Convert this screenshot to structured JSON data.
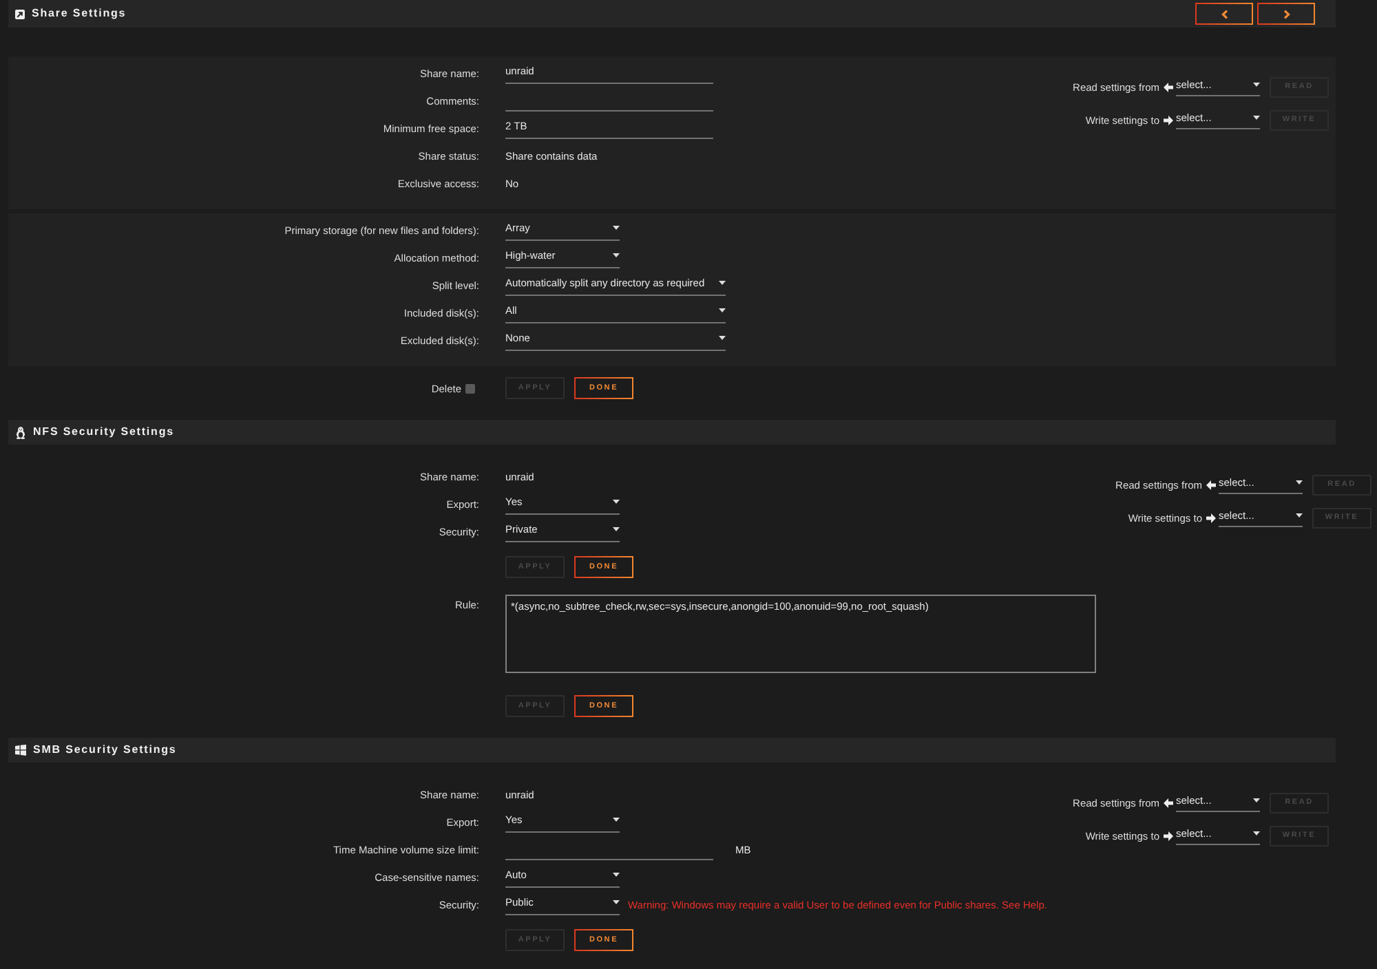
{
  "sections": [
    {
      "kind": "share",
      "title": "Share Settings",
      "pager": [
        {
          "kind": "previous"
        },
        {
          "kind": "next"
        }
      ],
      "blocks": [
        {
          "kind": "panel",
          "rows": [
            {
              "kind": "input",
              "label": "Share name:",
              "value": "unraid"
            },
            {
              "kind": "input",
              "label": "Comments:"
            },
            {
              "kind": "input",
              "label": "Minimum free space:",
              "value": "2 TB"
            },
            {
              "kind": "text",
              "label": "Share status:",
              "value": "Share contains data"
            },
            {
              "kind": "text",
              "label": "Exclusive access:",
              "value": "No"
            }
          ],
          "copy": [
            {
              "kind": "read",
              "label": "Read settings from",
              "value": "select...",
              "button": {
                "label": "READ",
                "disabled": true
              }
            },
            {
              "kind": "write",
              "label": "Write settings to",
              "value": "select...",
              "button": {
                "label": "WRITE",
                "disabled": true
              }
            }
          ]
        },
        {
          "kind": "panel",
          "rows": [
            {
              "kind": "select",
              "label": "Primary storage (for new files and folders):",
              "value": "Array"
            },
            {
              "kind": "select",
              "label": "Allocation method:",
              "value": "High-water"
            },
            {
              "kind": "wideselect",
              "label": "Split level:",
              "value": "Automatically split any directory as required"
            },
            {
              "kind": "wideselect",
              "label": "Included disk(s):",
              "value": "All"
            },
            {
              "kind": "wideselect",
              "label": "Excluded disk(s):",
              "value": "None"
            }
          ]
        },
        {
          "kind": "plain",
          "rows": [
            {
              "kind": "actions",
              "checkbox": {
                "label": "Delete",
                "checked": false
              },
              "buttons": [
                {
                  "label": "APPLY",
                  "disabled": true
                },
                {
                  "label": "DONE",
                  "disabled": false
                }
              ]
            }
          ]
        }
      ]
    },
    {
      "kind": "nfs",
      "title": "NFS Security Settings",
      "blocks": [
        {
          "kind": "plain",
          "rows": [
            {
              "kind": "text",
              "label": "Share name:",
              "value": "unraid"
            },
            {
              "kind": "select",
              "label": "Export:",
              "value": "Yes"
            },
            {
              "kind": "select",
              "label": "Security:",
              "value": "Private"
            },
            {
              "kind": "actions",
              "buttons": [
                {
                  "label": "APPLY",
                  "disabled": true
                },
                {
                  "label": "DONE",
                  "disabled": false
                }
              ]
            },
            {
              "kind": "textarea",
              "label": "Rule:",
              "value": "*(async,no_subtree_check,rw,sec=sys,insecure,anongid=100,anonuid=99,no_root_squash)"
            },
            {
              "kind": "actions",
              "buttons": [
                {
                  "label": "APPLY",
                  "disabled": true
                },
                {
                  "label": "DONE",
                  "disabled": false
                }
              ]
            }
          ],
          "copy": [
            {
              "kind": "read",
              "label": "Read settings from",
              "value": "select...",
              "button": {
                "label": "READ",
                "disabled": true
              }
            },
            {
              "kind": "write",
              "label": "Write settings to",
              "value": "select...",
              "button": {
                "label": "WRITE",
                "disabled": true
              }
            }
          ]
        }
      ]
    },
    {
      "kind": "smb",
      "title": "SMB Security Settings",
      "blocks": [
        {
          "kind": "plain",
          "rows": [
            {
              "kind": "text",
              "label": "Share name:",
              "value": "unraid"
            },
            {
              "kind": "select",
              "label": "Export:",
              "value": "Yes"
            },
            {
              "kind": "input",
              "label": "Time Machine volume size limit:",
              "unit": "MB"
            },
            {
              "kind": "select",
              "label": "Case-sensitive names:",
              "value": "Auto"
            },
            {
              "kind": "select",
              "label": "Security:",
              "value": "Public",
              "note": "Warning: Windows may require a valid User to be defined even for Public shares. See Help."
            },
            {
              "kind": "actions",
              "buttons": [
                {
                  "label": "APPLY",
                  "disabled": true
                },
                {
                  "label": "DONE",
                  "disabled": false
                }
              ]
            }
          ],
          "copy": [
            {
              "kind": "read",
              "label": "Read settings from",
              "value": "select...",
              "button": {
                "label": "READ",
                "disabled": true
              }
            },
            {
              "kind": "write",
              "label": "Write settings to",
              "value": "select...",
              "button": {
                "label": "WRITE",
                "disabled": true
              }
            }
          ]
        }
      ]
    }
  ]
}
